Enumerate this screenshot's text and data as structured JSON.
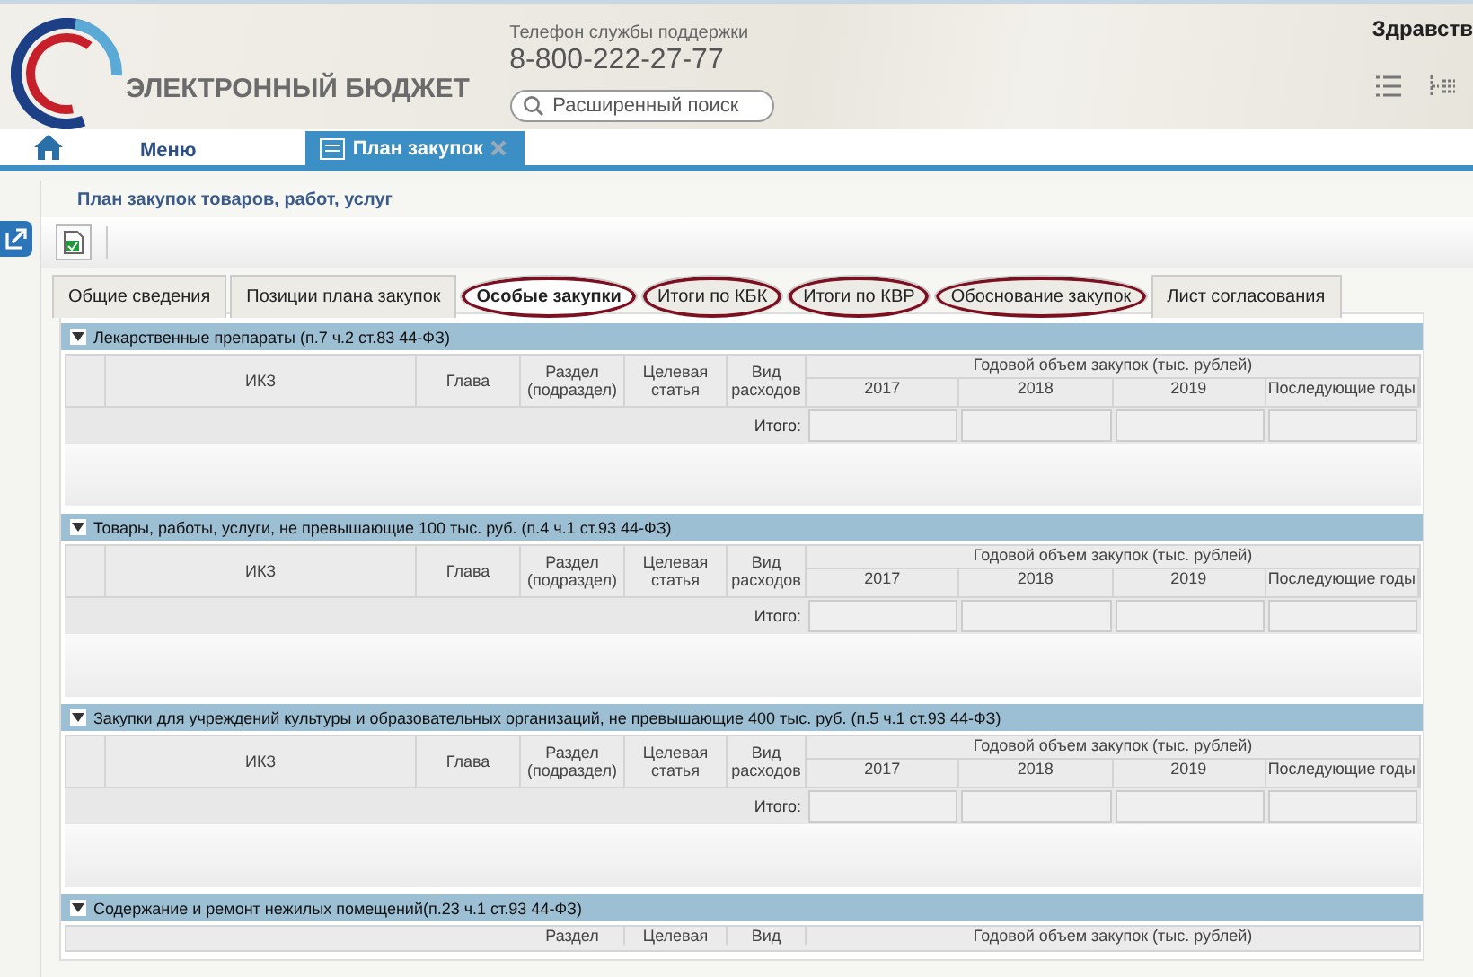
{
  "header": {
    "logo_text": "ЭЛЕКТРОННЫЙ БЮДЖЕТ",
    "support_label": "Телефон службы поддержки",
    "support_phone": "8-800-222-27-77",
    "search": {
      "placeholder": "Расширенный поиск"
    },
    "greeting": "Здравств"
  },
  "nav": {
    "menu": "Меню",
    "tabs": [
      {
        "label": "План закупок",
        "selected": true
      }
    ]
  },
  "page": {
    "title": "План закупок товаров, работ, услуг",
    "tabs": [
      {
        "label": "Общие сведения",
        "selected": false,
        "circled": false
      },
      {
        "label": "Позиции плана закупок",
        "selected": false,
        "circled": false
      },
      {
        "label": "Особые закупки",
        "selected": true,
        "circled": true
      },
      {
        "label": "Итоги по КБК",
        "selected": false,
        "circled": true
      },
      {
        "label": "Итоги по КВР",
        "selected": false,
        "circled": true
      },
      {
        "label": "Обоснование закупок",
        "selected": false,
        "circled": true
      },
      {
        "label": "Лист согласования",
        "selected": false,
        "circled": false
      }
    ],
    "sections": [
      {
        "title": "Лекарственные препараты (п.7 ч.2 ст.83 44-ФЗ)",
        "expanded": true,
        "columns": [
          "ИКЗ",
          "Глава",
          "Раздел (подраздел)",
          "Целевая статья",
          "Вид расходов"
        ],
        "group_header": "Годовой объем закупок (тыс. рублей)",
        "years": [
          "2017",
          "2018",
          "2019",
          "Последующие годы"
        ],
        "total_label": "Итого:"
      },
      {
        "title": "Товары, работы, услуги, не превышающие 100 тыс. руб. (п.4 ч.1 ст.93 44-ФЗ)",
        "expanded": true,
        "columns": [
          "ИКЗ",
          "Глава",
          "Раздел (подраздел)",
          "Целевая статья",
          "Вид расходов"
        ],
        "group_header": "Годовой объем закупок (тыс. рублей)",
        "years": [
          "2017",
          "2018",
          "2019",
          "Последующие годы"
        ],
        "total_label": "Итого:"
      },
      {
        "title": "Закупки для учреждений культуры и образовательных организаций, не превышающие 400 тыс. руб. (п.5 ч.1 ст.93 44-ФЗ)",
        "expanded": true,
        "columns": [
          "ИКЗ",
          "Глава",
          "Раздел (подраздел)",
          "Целевая статья",
          "Вид расходов"
        ],
        "group_header": "Годовой объем закупок (тыс. рублей)",
        "years": [
          "2017",
          "2018",
          "2019",
          "Последующие годы"
        ],
        "total_label": "Итого:"
      },
      {
        "title": "Содержание и ремонт нежилых помещений(п.23 ч.1 ст.93 44-ФЗ)",
        "expanded": true,
        "columns": [
          "Раздел",
          "Целевая",
          "Вид"
        ],
        "group_header": "Годовой объем закупок (тыс. рублей)"
      }
    ]
  }
}
